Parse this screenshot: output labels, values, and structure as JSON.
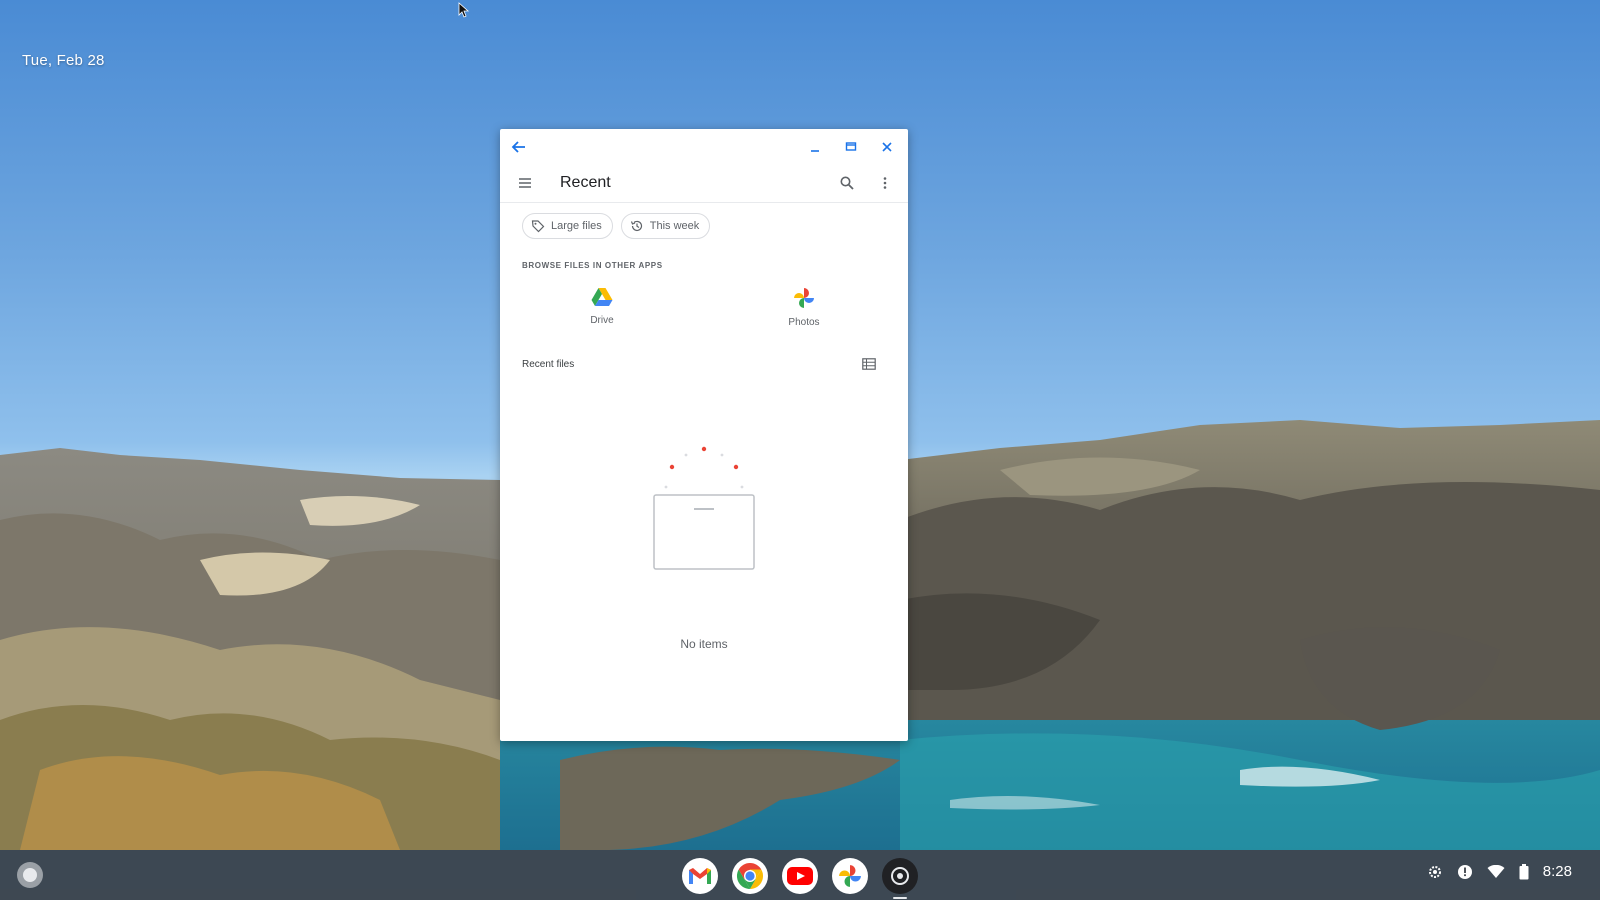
{
  "desktop": {
    "date_label": "Tue, Feb 28"
  },
  "files_window": {
    "title": "Recent",
    "filter_chips": [
      {
        "label": "Large files",
        "icon": "tag-icon"
      },
      {
        "label": "This week",
        "icon": "history-icon"
      }
    ],
    "other_apps_caption": "BROWSE FILES IN OTHER APPS",
    "other_apps": [
      {
        "label": "Drive",
        "icon": "google-drive-icon"
      },
      {
        "label": "Photos",
        "icon": "google-photos-icon"
      }
    ],
    "recent_files_header": "Recent files",
    "empty_state_text": "No items",
    "accent_color": "#1a73e8"
  },
  "shelf": {
    "pinned_apps": [
      {
        "name": "Gmail",
        "icon": "gmail-icon"
      },
      {
        "name": "Chrome",
        "icon": "chrome-icon"
      },
      {
        "name": "YouTube",
        "icon": "youtube-icon"
      },
      {
        "name": "Photos",
        "icon": "google-photos-icon"
      },
      {
        "name": "Files",
        "icon": "files-app-icon",
        "active": true
      }
    ],
    "tray": {
      "time": "8:28",
      "icons": [
        "settings-icon",
        "notification-icon",
        "wifi-icon",
        "battery-icon"
      ]
    }
  }
}
